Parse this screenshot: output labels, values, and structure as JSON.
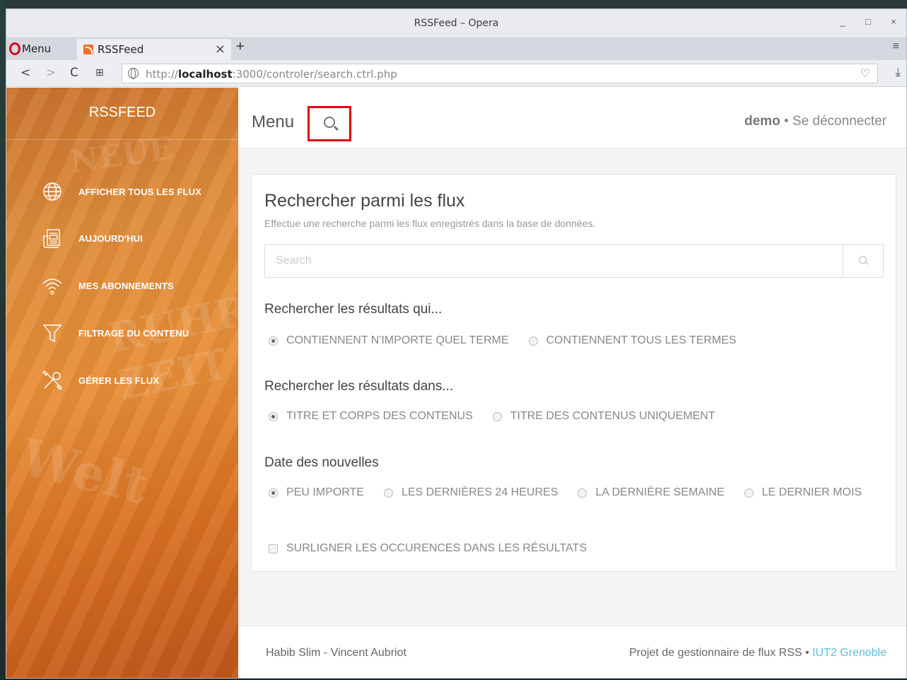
{
  "window": {
    "title": "RSSFeed – Opera",
    "controls": [
      "_",
      "□",
      "×"
    ]
  },
  "browser": {
    "menu_label": "Menu",
    "tab_title": "RSSFeed",
    "tab_close": "×",
    "new_tab": "+",
    "url_prefix": "http://",
    "url_host": "localhost",
    "url_rest": ":3000/controler/search.ctrl.php"
  },
  "sidebar": {
    "brand": "RSSFEED",
    "items": [
      {
        "label": "AFFICHER TOUS LES FLUX",
        "icon": "globe-icon"
      },
      {
        "label": "AUJOURD'HUI",
        "icon": "newspaper-icon"
      },
      {
        "label": "MES ABONNEMENTS",
        "icon": "wifi-icon"
      },
      {
        "label": "FILTRAGE DU CONTENU",
        "icon": "filter-icon"
      },
      {
        "label": "GÉRER LES FLUX",
        "icon": "tools-icon"
      }
    ]
  },
  "topnav": {
    "menu_label": "Menu",
    "username": "demo",
    "separator": " • ",
    "logout": "Se déconnecter"
  },
  "search": {
    "title": "Rechercher parmi les flux",
    "description": "Effectue une recherche parmi les flux enregistrés dans la base de données.",
    "placeholder": "Search",
    "sections": [
      {
        "title": "Rechercher les résultats qui...",
        "options": [
          "CONTIENNENT N'IMPORTE QUEL TERME",
          "CONTIENNENT TOUS LES TERMES"
        ],
        "selected": 0
      },
      {
        "title": "Rechercher les résultats dans...",
        "options": [
          "TITRE ET CORPS DES CONTENUS",
          "TITRE DES CONTENUS UNIQUEMENT"
        ],
        "selected": 0
      },
      {
        "title": "Date des nouvelles",
        "options": [
          "PEU IMPORTE",
          "LES DERNIÈRES 24 HEURES",
          "LA DERNIÈRE SEMAINE",
          "LE DERNIER MOIS"
        ],
        "selected": 0
      }
    ],
    "highlight_label": "SURLIGNER LES OCCURENCES DANS LES RÉSULTATS",
    "highlight_checked": false
  },
  "footer": {
    "authors": "Habib Slim - Vincent Aubriot",
    "project": "Projet de gestionnaire de flux RSS",
    "separator": " • ",
    "school": "IUT2 Grenoble"
  },
  "colors": {
    "accent_red": "#e0000f",
    "link": "#5bc0de",
    "sidebar": "#e88f38"
  }
}
